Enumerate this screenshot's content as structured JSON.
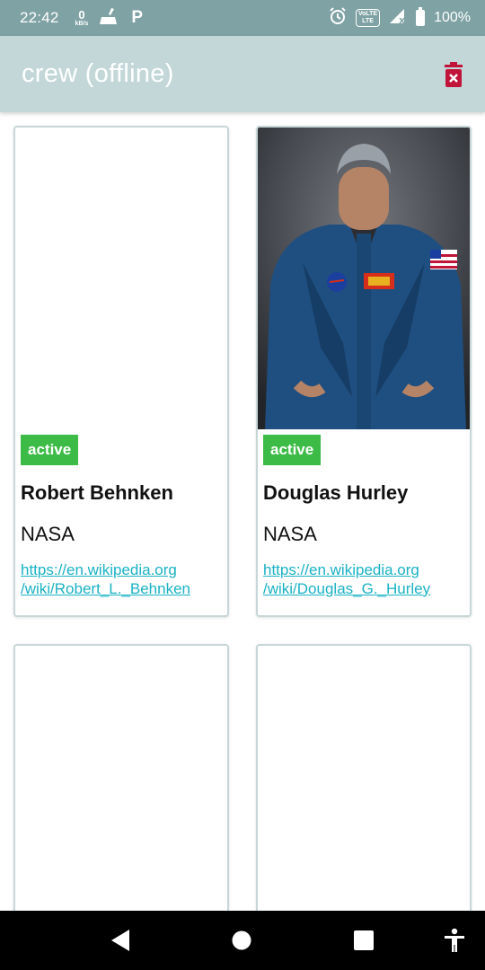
{
  "status_bar": {
    "time": "22:42",
    "net_speed_value": "0",
    "net_speed_unit": "kB/s",
    "volte_top": "VoLTE",
    "volte_bottom": "LTE",
    "battery_text": "100%",
    "icons": [
      "broom-icon",
      "parking-icon",
      "alarm-icon",
      "volte-icon",
      "signal-icon",
      "battery-icon"
    ]
  },
  "app_bar": {
    "title": "crew (offline)",
    "delete_icon": "delete-icon",
    "delete_color": "#c0143a"
  },
  "crew": [
    {
      "status": "active",
      "name": "Robert Behnken",
      "agency": "NASA",
      "link_line1": "https://en.wikipedia.org",
      "link_line2": "/wiki/Robert_L._Behnken",
      "has_photo": false
    },
    {
      "status": "active",
      "name": "Douglas Hurley",
      "agency": "NASA",
      "link_line1": "https://en.wikipedia.org",
      "link_line2": "/wiki/Douglas_G._Hurley",
      "has_photo": true
    },
    {
      "has_photo": false
    },
    {
      "has_photo": false
    }
  ],
  "colors": {
    "status_bar": "#7fa2a4",
    "app_bar": "#c3d7d8",
    "badge": "#3dbb47",
    "link": "#19b2c4"
  },
  "nav_bar": {
    "icons": [
      "back-icon",
      "home-icon",
      "recents-icon",
      "accessibility-icon"
    ]
  }
}
